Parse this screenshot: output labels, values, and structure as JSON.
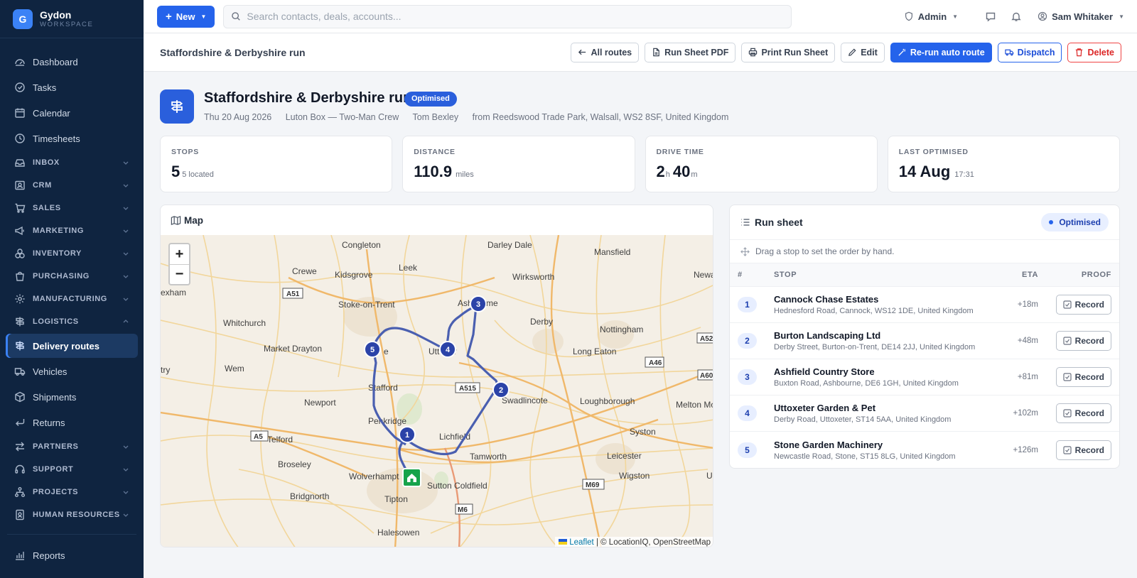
{
  "brand": {
    "name": "Gydon",
    "sub": "WORKSPACE",
    "initial": "G"
  },
  "sidebar": {
    "items": [
      {
        "label": "Dashboard"
      },
      {
        "label": "Tasks"
      },
      {
        "label": "Calendar"
      },
      {
        "label": "Timesheets"
      }
    ],
    "groups": [
      {
        "label": "INBOX"
      },
      {
        "label": "CRM"
      },
      {
        "label": "SALES"
      },
      {
        "label": "MARKETING"
      },
      {
        "label": "INVENTORY"
      },
      {
        "label": "PURCHASING"
      },
      {
        "label": "MANUFACTURING"
      },
      {
        "label": "LOGISTICS"
      }
    ],
    "logistics_items": [
      {
        "label": "Delivery routes"
      },
      {
        "label": "Vehicles"
      },
      {
        "label": "Shipments"
      },
      {
        "label": "Returns"
      }
    ],
    "groups_after": [
      {
        "label": "PARTNERS"
      },
      {
        "label": "SUPPORT"
      },
      {
        "label": "PROJECTS"
      },
      {
        "label": "HUMAN RESOURCES"
      }
    ],
    "footer_item": {
      "label": "Reports"
    }
  },
  "topbar": {
    "new_label": "New",
    "search_placeholder": "Search contacts, deals, accounts...",
    "role": "Admin",
    "user": "Sam Whitaker"
  },
  "subheader": {
    "title": "Staffordshire & Derbyshire run",
    "actions": {
      "all_routes": "All routes",
      "run_sheet_pdf": "Run Sheet PDF",
      "print": "Print Run Sheet",
      "edit": "Edit",
      "rerun": "Re-run auto route",
      "dispatch": "Dispatch",
      "delete": "Delete"
    }
  },
  "route": {
    "title": "Staffordshire & Derbyshire run",
    "status": "Optimised",
    "date": "Thu 20 Aug 2026",
    "vehicle": "Luton Box — Two-Man Crew",
    "driver": "Tom Bexley",
    "origin": "from Reedswood Trade Park, Walsall, WS2 8SF, United Kingdom"
  },
  "stats": {
    "stops": {
      "label": "STOPS",
      "value": "5",
      "sub": "5 located"
    },
    "distance": {
      "label": "DISTANCE",
      "value": "110.9",
      "sub": "miles"
    },
    "drive_time": {
      "label": "DRIVE TIME",
      "hours": "2",
      "h_unit": "h",
      "minutes": "40",
      "m_unit": "m"
    },
    "last_optimised": {
      "label": "LAST OPTIMISED",
      "value": "14 Aug",
      "sub": "17:31"
    }
  },
  "map": {
    "title": "Map",
    "zoom_in": "+",
    "zoom_out": "−",
    "attribution_leaflet": "Leaflet",
    "attribution_rest": "| © LocationIQ, OpenStreetMap",
    "places": [
      "Congleton",
      "Darley Dale",
      "Mansfield",
      "Crewe",
      "Kidsgrove",
      "Leek",
      "Wirksworth",
      "Newark",
      "exham",
      "Stoke-on-Trent",
      "Ash",
      "me",
      "Whitchurch",
      "Derby",
      "Nottingham",
      "Market Drayton",
      "Utt",
      "er",
      "Long Eaton",
      "Wem",
      "Stafford",
      "Swadlincote",
      "Loughborough",
      "Newport",
      "Melton Mowbra",
      "Penkridge",
      "Lichfield",
      "Syston",
      "Telford",
      "Leicester",
      "Broseley",
      "Tamworth",
      "Wigston",
      "Wolverhampt",
      "Up",
      "Bridgnorth",
      "Sutton Coldfield",
      "Tipton",
      "Halesowen",
      "try",
      "e"
    ],
    "roads": [
      "A51",
      "A52",
      "A46",
      "A60",
      "A515",
      "A5",
      "M69",
      "M6"
    ],
    "markers": [
      "1",
      "2",
      "3",
      "4",
      "5"
    ]
  },
  "runsheet": {
    "title": "Run sheet",
    "status": "Optimised",
    "hint": "Drag a stop to set the order by hand.",
    "columns": {
      "num": "#",
      "stop": "STOP",
      "eta": "ETA",
      "proof": "PROOF"
    },
    "record_label": "Record",
    "rows": [
      {
        "num": "1",
        "name": "Cannock Chase Estates",
        "address": "Hednesford Road, Cannock, WS12 1DE, United Kingdom",
        "eta": "+18m"
      },
      {
        "num": "2",
        "name": "Burton Landscaping Ltd",
        "address": "Derby Street, Burton-on-Trent, DE14 2JJ, United Kingdom",
        "eta": "+48m"
      },
      {
        "num": "3",
        "name": "Ashfield Country Store",
        "address": "Buxton Road, Ashbourne, DE6 1GH, United Kingdom",
        "eta": "+81m"
      },
      {
        "num": "4",
        "name": "Uttoxeter Garden & Pet",
        "address": "Derby Road, Uttoxeter, ST14 5AA, United Kingdom",
        "eta": "+102m"
      },
      {
        "num": "5",
        "name": "Stone Garden Machinery",
        "address": "Newcastle Road, Stone, ST15 8LG, United Kingdom",
        "eta": "+126m"
      }
    ]
  },
  "colors": {
    "accent": "#2563eb",
    "sidebar": "#0f2440",
    "danger": "#dc2626",
    "route": "#4a5fb0",
    "depot": "#16a34a"
  }
}
